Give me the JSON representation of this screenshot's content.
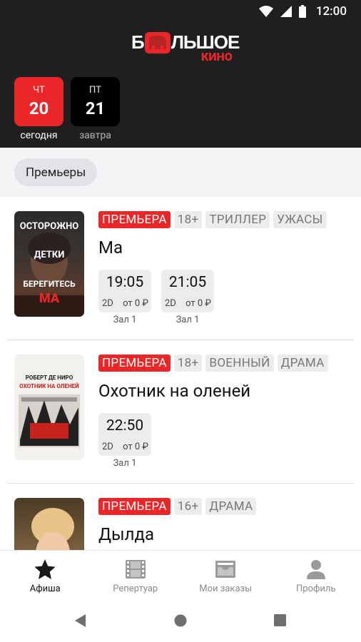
{
  "status_bar": {
    "time": "12:00"
  },
  "logo": {
    "line1_left": "Б",
    "line1_right": "ЛЬШОЕ",
    "line2": "КИНО"
  },
  "dates": [
    {
      "dow": "ЧТ",
      "day": "20",
      "label": "сегодня",
      "active": true
    },
    {
      "dow": "ПТ",
      "day": "21",
      "label": "завтра",
      "active": false
    }
  ],
  "filter": {
    "chip_label": "Премьеры"
  },
  "movies": [
    {
      "tags": [
        "ПРЕМЬЕРА",
        "18+",
        "ТРИЛЛЕР",
        "УЖАСЫ"
      ],
      "title": "Ма",
      "poster_text": {
        "line1": "ОСТОРОЖНО",
        "line2": "ДЕТКИ",
        "line3": "БЕРЕГИТЕСЬ",
        "line4": "МА"
      },
      "sessions": [
        {
          "time": "19:05",
          "format": "2D",
          "price": "от 0 ₽",
          "hall": "Зал 1"
        },
        {
          "time": "21:05",
          "format": "2D",
          "price": "от 0 ₽",
          "hall": "Зал 1"
        }
      ]
    },
    {
      "tags": [
        "ПРЕМЬЕРА",
        "18+",
        "ВОЕННЫЙ",
        "ДРАМА"
      ],
      "title": "Охотник на оленей",
      "poster_text": {
        "line1": "РОБЕРТ ДЕ НИРО",
        "line2": "ОХОТНИК НА ОЛЕНЕЙ"
      },
      "sessions": [
        {
          "time": "22:50",
          "format": "2D",
          "price": "от 0 ₽",
          "hall": "Зал 1"
        }
      ]
    },
    {
      "tags": [
        "ПРЕМЬЕРА",
        "16+",
        "ДРАМА"
      ],
      "title": "Дылда"
    }
  ],
  "bottom_nav": [
    {
      "label": "Афиша",
      "icon": "star-icon",
      "active": true
    },
    {
      "label": "Репертуар",
      "icon": "film-icon",
      "active": false
    },
    {
      "label": "Мои заказы",
      "icon": "inbox-icon",
      "active": false
    },
    {
      "label": "Профиль",
      "icon": "person-icon",
      "active": false
    }
  ],
  "colors": {
    "accent": "#ea2628",
    "header_bg": "#1f1f1f"
  }
}
